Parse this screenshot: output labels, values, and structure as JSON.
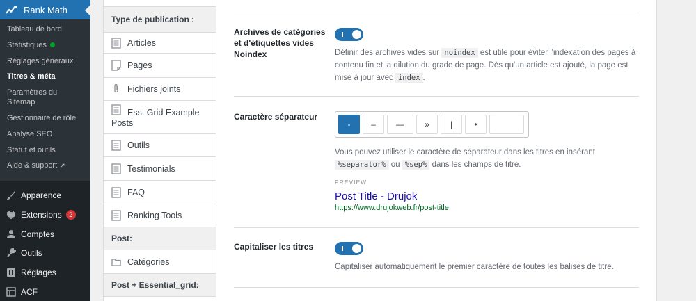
{
  "sidebar": {
    "rank_math_label": "Rank Math",
    "submenu": [
      {
        "label": "Tableau de bord"
      },
      {
        "label": "Statistiques"
      },
      {
        "label": "Réglages généraux"
      },
      {
        "label": "Titres & méta"
      },
      {
        "label": "Paramètres du Sitemap"
      },
      {
        "label": "Gestionnaire de rôle"
      },
      {
        "label": "Analyse SEO"
      },
      {
        "label": "Statut et outils"
      },
      {
        "label": "Aide & support"
      }
    ],
    "menu": [
      {
        "label": "Apparence",
        "icon": "brush-icon"
      },
      {
        "label": "Extensions",
        "icon": "plugin-icon",
        "badge": "2"
      },
      {
        "label": "Comptes",
        "icon": "user-icon"
      },
      {
        "label": "Outils",
        "icon": "wrench-icon"
      },
      {
        "label": "Réglages",
        "icon": "settings-icon"
      },
      {
        "label": "ACF",
        "icon": "acf-icon"
      }
    ],
    "colors": {
      "bg": "#1d2327",
      "active": "#2271b1",
      "status_dot": "#00a32a",
      "badge": "#d63638"
    }
  },
  "post_types": {
    "header_1": "Type de publication :",
    "items": [
      "Articles",
      "Pages",
      "Fichiers joints",
      "Ess. Grid Example Posts",
      "Outils",
      "Testimonials",
      "FAQ",
      "Ranking Tools"
    ],
    "header_2": "Post:",
    "taxonomy_item": "Catégories",
    "header_3": "Post + Essential_grid:"
  },
  "settings": {
    "noindex": {
      "label": "Archives de catégories et d'étiquettes vides Noindex",
      "enabled": true,
      "desc_1": "Définir des archives vides sur",
      "code_1": "noindex",
      "desc_2": "est utile pour éviter l'indexation des pages à contenu fin et la dilution du grade de page. Dès qu'un article est ajouté, la page est mise à jour avec",
      "code_2": "index",
      "desc_3": "."
    },
    "separator": {
      "label": "Caractère séparateur",
      "options": [
        "-",
        "–",
        "—",
        "»",
        "|",
        "•"
      ],
      "selected": "-",
      "desc_1": "Vous pouvez utiliser le caractère de séparateur dans les titres en insérant",
      "code_1": "%separator%",
      "desc_or": "ou",
      "code_2": "%sep%",
      "desc_2": "dans les champs de titre.",
      "preview_label": "PREVIEW",
      "preview_title": "Post Title - Drujok",
      "preview_url": "https://www.drujokweb.fr/post-title"
    },
    "capitalize": {
      "label": "Capitaliser les titres",
      "enabled": true,
      "desc": "Capitaliser automatiquement le premier caractère de toutes les balises de titre."
    },
    "accent": "#2271b1"
  }
}
